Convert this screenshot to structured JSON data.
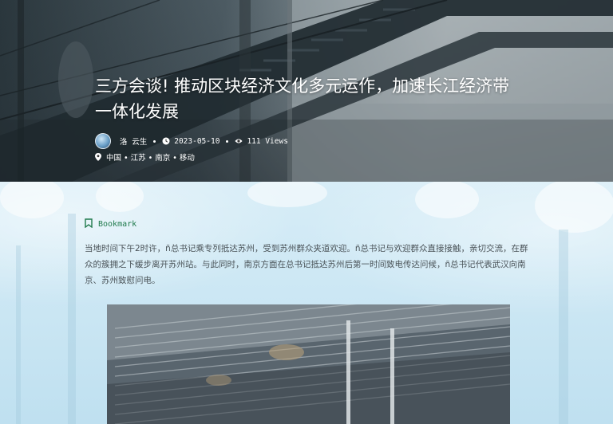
{
  "article": {
    "title": "三方会谈! 推动区块经济文化多元运作，加速长江经济带一体化发展",
    "author": "洛 云生",
    "date": "2023-05-10",
    "views": "111 Views",
    "location": "中国 • 江苏 • 南京 • 移动",
    "bookmark_label": "Bookmark",
    "body": "当地时间下午2时许，ñ总书记乘专列抵达苏州，受到苏州群众夹道欢迎。ñ总书记与欢迎群众直接接触，亲切交流，在群众的簇拥之下缓步离开苏州站。与此同时，南京方面在总书记抵达苏州后第一时间致电传达问候，ñ总书记代表武汉向南京、苏州致慰问电。"
  },
  "icons": {
    "clock": "clock-icon",
    "eye": "eye-icon",
    "pin": "map-pin-icon",
    "bookmark": "bookmark-icon"
  },
  "colors": {
    "accent": "#1f7a4c",
    "body_text": "#4a5358",
    "page_bg": "#cfe7f2"
  }
}
